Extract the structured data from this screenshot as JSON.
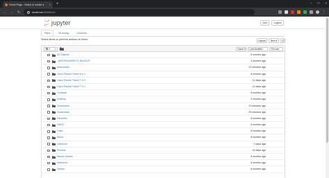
{
  "browser": {
    "tab_title": "Home Page - Select or create a",
    "tab_close": "×",
    "new_tab": "+",
    "url_host": "localhost",
    "url_path": ":8888/tree",
    "window_buttons": [
      "–",
      "□",
      "×"
    ]
  },
  "header": {
    "logo_text": "jupyter",
    "quit_label": "Quit",
    "logout_label": "Logout"
  },
  "tabs": [
    {
      "label": "Files",
      "active": true
    },
    {
      "label": "Running",
      "active": false
    },
    {
      "label": "Clusters",
      "active": false
    }
  ],
  "toolbar": {
    "select_hint": "Select items to perform actions on them.",
    "upload_label": "Upload",
    "new_label": "New ▾",
    "selected_count": "0",
    "sort_name_label": "Name",
    "sort_modified_label": "Last Modified",
    "sort_size_label": "File size"
  },
  "files": [
    {
      "name": "3D Objects",
      "modified": "6 months ago"
    },
    {
      "name": "_WRITEMONKEY3_BACKUP",
      "modified": "4 months ago"
    },
    {
      "name": "anaconda3",
      "modified": "12 minutes ago"
    },
    {
      "name": "Cisco Packet Tracer 6.0.1",
      "modified": "6 months ago"
    },
    {
      "name": "Cisco Packet Tracer 7.2.0",
      "modified": "11 days ago"
    },
    {
      "name": "Cisco Packet Tracer 7.2.1",
      "modified": "11 days ago"
    },
    {
      "name": "Contacts",
      "modified": "6 months ago"
    },
    {
      "name": "Desktop",
      "modified": "2 months ago"
    },
    {
      "name": "Documents",
      "modified": "12 minutes ago"
    },
    {
      "name": "Downloads",
      "modified": "39 minutes ago"
    },
    {
      "name": "Favorites",
      "modified": "6 months ago"
    },
    {
      "name": "GNS3",
      "modified": "6 months ago"
    },
    {
      "name": "Links",
      "modified": "6 months ago"
    },
    {
      "name": "Music",
      "modified": "6 months ago"
    },
    {
      "name": "OneDrive",
      "modified": "2 days ago"
    },
    {
      "name": "Pictures",
      "modified": "10 days ago"
    },
    {
      "name": "Saved Games",
      "modified": "6 months ago"
    },
    {
      "name": "Searches",
      "modified": "6 months ago"
    },
    {
      "name": "Videos",
      "modified": "6 months ago"
    }
  ],
  "colors": {
    "link": "#337ab7",
    "folder": "#555555",
    "jupyter_orange": "#f37726"
  }
}
